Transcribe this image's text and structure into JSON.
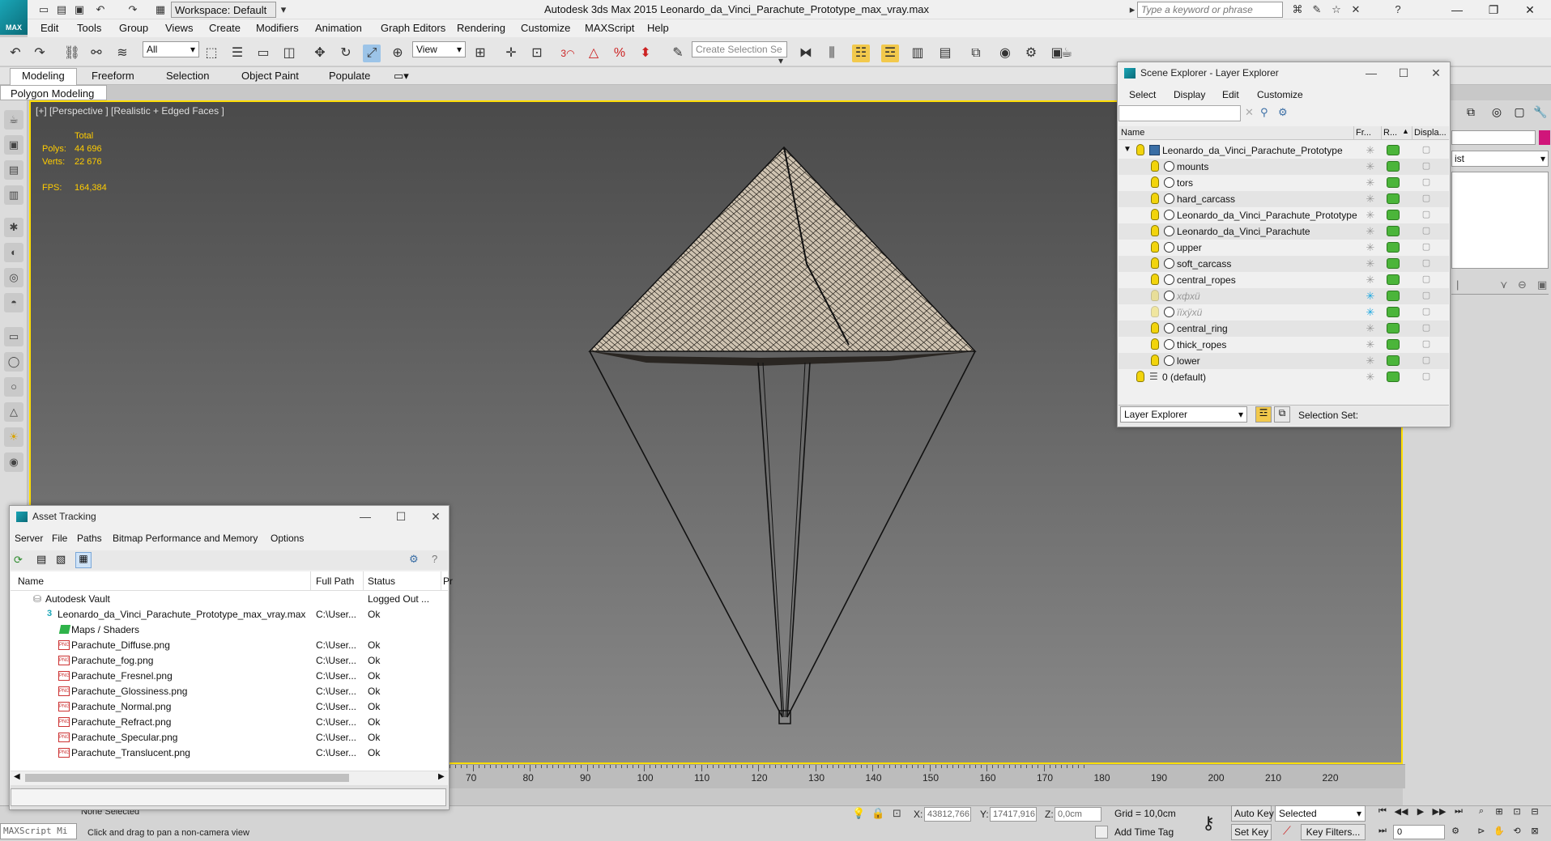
{
  "app": {
    "logo_text": "MAX",
    "title": "Autodesk 3ds Max  2015     Leonardo_da_Vinci_Parachute_Prototype_max_vray.max"
  },
  "workspace": "Workspace: Default",
  "search_placeholder": "Type a keyword or phrase",
  "menus": [
    "Edit",
    "Tools",
    "Group",
    "Views",
    "Create",
    "Modifiers",
    "Animation",
    "Graph Editors",
    "Rendering",
    "Customize",
    "MAXScript",
    "Help"
  ],
  "toolbar": {
    "selection_filter": "All",
    "ref_coord": "View",
    "named_selection": "Create Selection Se",
    "snap_label": "3"
  },
  "ribbon": {
    "tabs": [
      "Modeling",
      "Freeform",
      "Selection",
      "Object Paint",
      "Populate"
    ],
    "sub": "Polygon Modeling"
  },
  "viewport": {
    "label": "[+] [Perspective ] [Realistic + Edged Faces ]",
    "stats_header": "Total",
    "polys_label": "Polys:",
    "polys_value": "44 696",
    "verts_label": "Verts:",
    "verts_value": "22 676",
    "fps_label": "FPS:",
    "fps_value": "164,384"
  },
  "scene_explorer": {
    "title": "Scene Explorer - Layer Explorer",
    "menus": [
      "Select",
      "Display",
      "Edit",
      "Customize"
    ],
    "columns": [
      "Name",
      "Fr...",
      "R...",
      "Displa..."
    ],
    "root": "Leonardo_da_Vinci_Parachute_Prototype",
    "items": [
      "mounts",
      "tors",
      "hard_carcass",
      "Leonardo_da_Vinci_Parachute_Prototype",
      "Leonardo_da_Vinci_Parachute",
      "upper",
      "soft_carcass",
      "central_ropes",
      "xфхü",
      "ïïxÿxü",
      "central_ring",
      "thick_ropes",
      "lower"
    ],
    "default_layer": "0 (default)",
    "mode": "Layer Explorer",
    "selection_set_label": "Selection Set:"
  },
  "right_panel": {
    "list_label": "ist"
  },
  "asset_tracking": {
    "title": "Asset Tracking",
    "menus": [
      "Server",
      "File",
      "Paths",
      "Bitmap Performance and Memory",
      "Options"
    ],
    "columns": [
      "Name",
      "Full Path",
      "Status",
      "Pr"
    ],
    "vault": {
      "name": "Autodesk Vault",
      "status": "Logged Out ..."
    },
    "scene_file": {
      "name": "Leonardo_da_Vinci_Parachute_Prototype_max_vray.max",
      "path": "C:\\User...",
      "status": "Ok"
    },
    "folder": "Maps / Shaders",
    "png_badge": "PNG",
    "maps": [
      {
        "name": "Parachute_Diffuse.png",
        "path": "C:\\User...",
        "status": "Ok"
      },
      {
        "name": "Parachute_fog.png",
        "path": "C:\\User...",
        "status": "Ok"
      },
      {
        "name": "Parachute_Fresnel.png",
        "path": "C:\\User...",
        "status": "Ok"
      },
      {
        "name": "Parachute_Glossiness.png",
        "path": "C:\\User...",
        "status": "Ok"
      },
      {
        "name": "Parachute_Normal.png",
        "path": "C:\\User...",
        "status": "Ok"
      },
      {
        "name": "Parachute_Refract.png",
        "path": "C:\\User...",
        "status": "Ok"
      },
      {
        "name": "Parachute_Specular.png",
        "path": "C:\\User...",
        "status": "Ok"
      },
      {
        "name": "Parachute_Translucent.png",
        "path": "C:\\User...",
        "status": "Ok"
      }
    ]
  },
  "timeline": {
    "ticks": [
      "70",
      "80",
      "90",
      "100",
      "110",
      "120",
      "130",
      "140",
      "150",
      "160",
      "170",
      "180",
      "190",
      "200",
      "210",
      "220"
    ]
  },
  "status": {
    "maxscript": "MAXScript Mi",
    "selection": "None Selected",
    "prompt": "Click and drag to pan a non-camera view",
    "x_label": "X:",
    "x_value": "43812,766",
    "y_label": "Y:",
    "y_value": "17417,916",
    "z_label": "Z:",
    "z_value": "0,0cm",
    "grid": "Grid = 10,0cm",
    "add_time_tag": "Add Time Tag",
    "auto_key": "Auto Key",
    "set_key": "Set Key",
    "key_mode": "Selected",
    "key_filters": "Key Filters...",
    "frame": "0"
  },
  "colors": {
    "viewport_border": "#ffde00",
    "stats_text": "#ffcc00",
    "brand": "#1aa6b7",
    "render_green": "#4bb53a"
  }
}
